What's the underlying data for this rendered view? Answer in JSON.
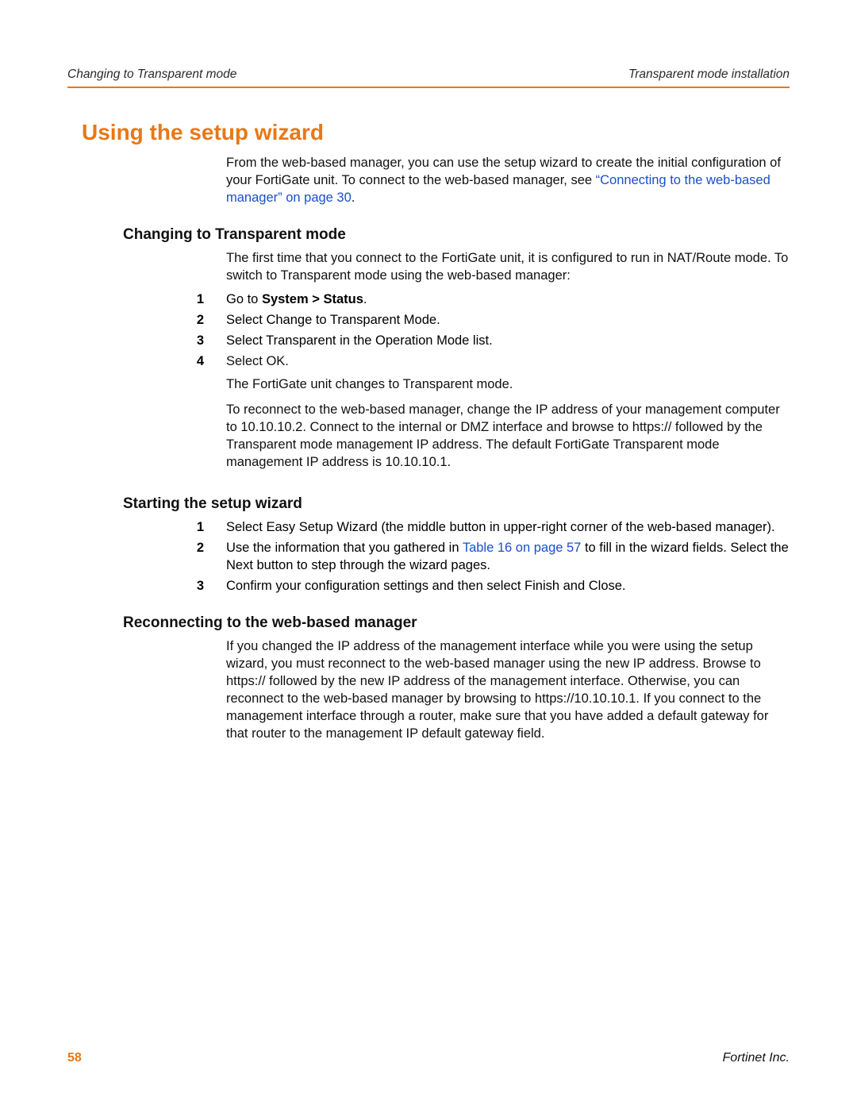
{
  "header": {
    "left": "Changing to Transparent mode",
    "right": "Transparent mode installation"
  },
  "h1": "Using the setup wizard",
  "intro": {
    "p1a": "From the web-based manager, you can use the setup wizard to create the initial configuration of your FortiGate unit. To connect to the web-based manager, see ",
    "link1": "“Connecting to the web-based manager” on page 30",
    "p1b": "."
  },
  "sec1": {
    "heading": "Changing to Transparent mode",
    "intro": "The first time that you connect to the FortiGate unit, it is configured to run in NAT/Route mode. To switch to Transparent mode using the web-based manager:",
    "steps": [
      {
        "n": "1",
        "prefix": "Go to ",
        "bold": "System > Status",
        "suffix": "."
      },
      {
        "n": "2",
        "text": "Select Change to Transparent Mode."
      },
      {
        "n": "3",
        "text": "Select Transparent in the Operation Mode list."
      },
      {
        "n": "4",
        "text": "Select OK."
      }
    ],
    "after1": "The FortiGate unit changes to Transparent mode.",
    "after2": "To reconnect to the web-based manager, change the IP address of your management computer to 10.10.10.2. Connect to the internal or DMZ interface and browse to https:// followed by the Transparent mode management IP address. The default FortiGate Transparent mode management IP address is 10.10.10.1."
  },
  "sec2": {
    "heading": "Starting the setup wizard",
    "steps": [
      {
        "n": "1",
        "text": "Select Easy Setup Wizard (the middle button in upper-right corner of the web-based manager)."
      },
      {
        "n": "2",
        "pre": "Use the information that you gathered in ",
        "link": "Table 16 on page 57",
        "post": " to fill in the wizard fields. Select the Next button to step through the wizard pages."
      },
      {
        "n": "3",
        "text": "Confirm your configuration settings and then select Finish and Close."
      }
    ]
  },
  "sec3": {
    "heading": "Reconnecting to the web-based manager",
    "body": "If you changed the IP address of the management interface while you were using the setup wizard, you must reconnect to the web-based manager using the new IP address. Browse to https:// followed by the new IP address of the management interface. Otherwise, you can reconnect to the web-based manager by browsing to https://10.10.10.1. If you connect to the management interface through a router, make sure that you have added a default gateway for that router to the management IP default gateway field."
  },
  "footer": {
    "page": "58",
    "company": "Fortinet Inc."
  }
}
